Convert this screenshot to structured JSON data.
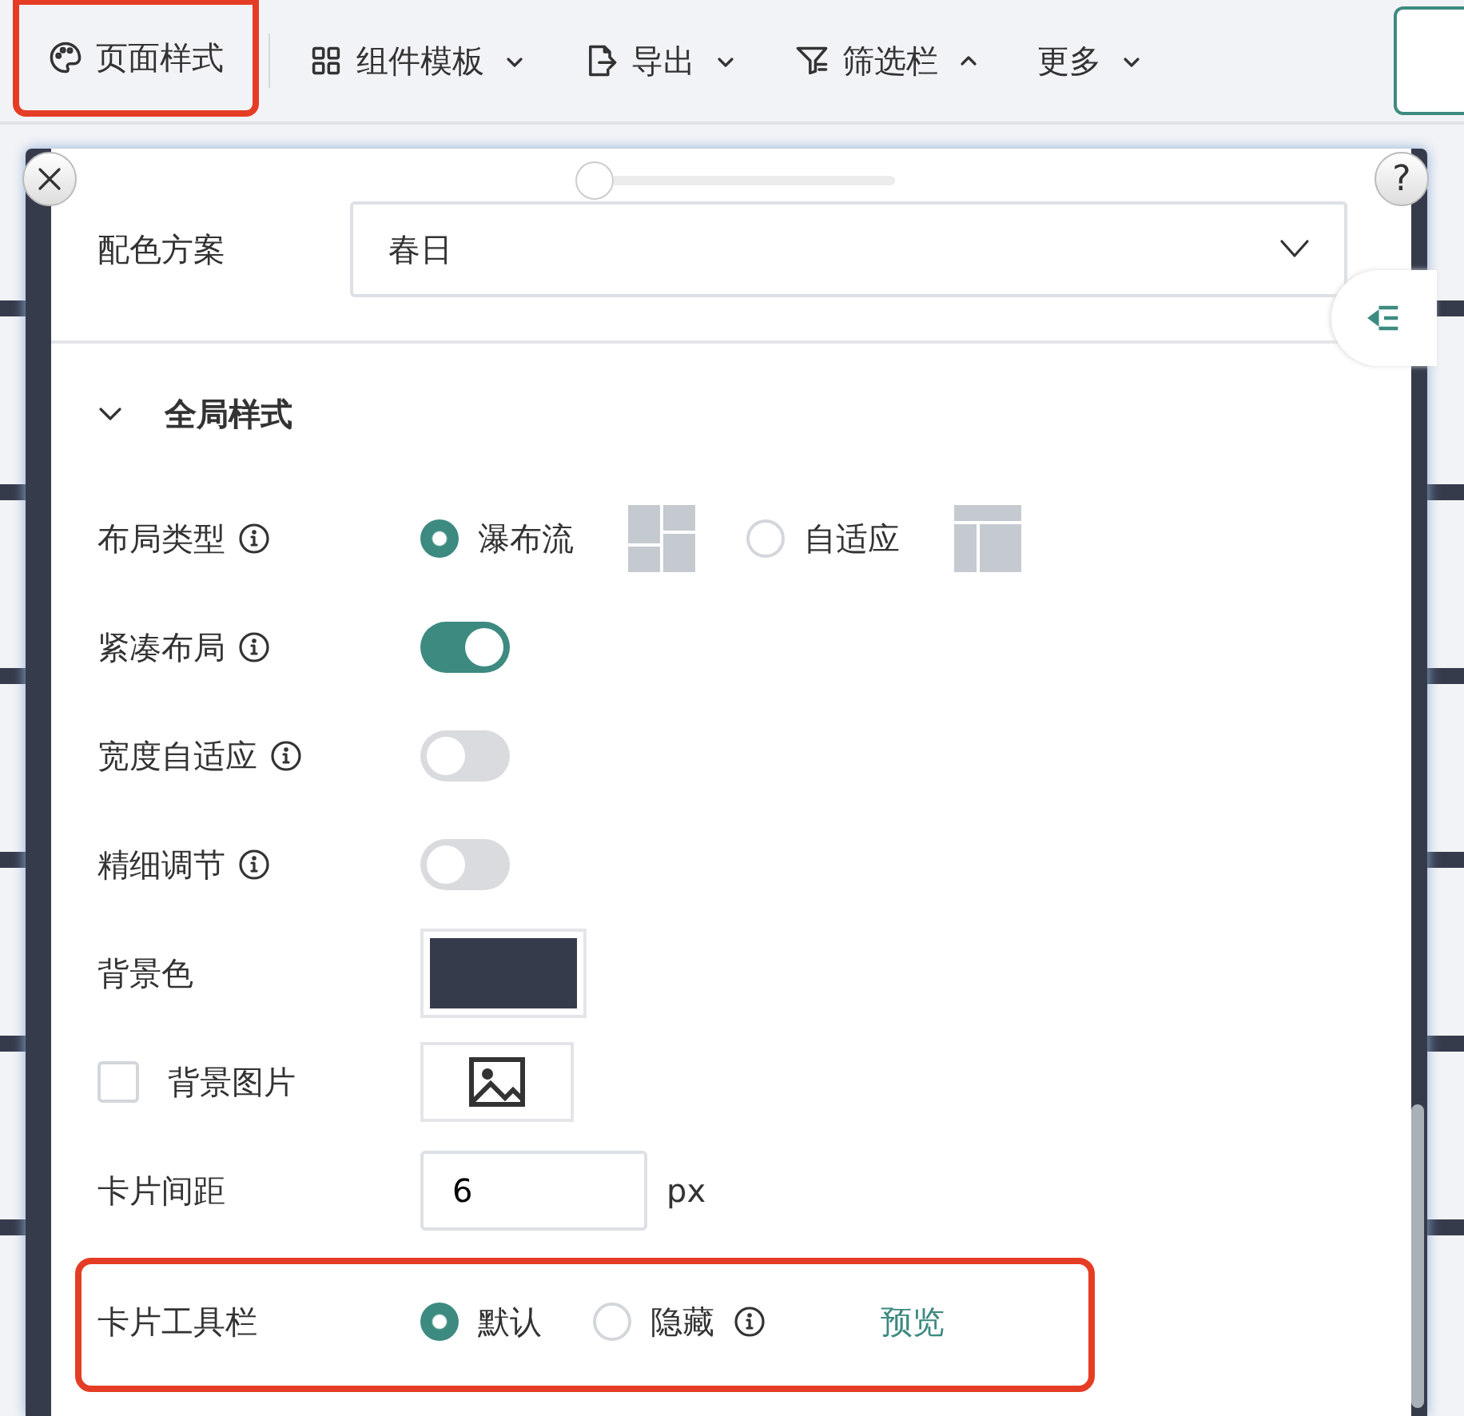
{
  "toolbar": {
    "items": [
      {
        "label": "页面样式",
        "dropdown": false,
        "highlighted": true
      },
      {
        "label": "组件模板",
        "dropdown": true,
        "expanded": false,
        "highlighted": false
      },
      {
        "label": "导出",
        "dropdown": true,
        "expanded": false,
        "highlighted": false
      },
      {
        "label": "筛选栏",
        "dropdown": true,
        "expanded": true,
        "highlighted": false
      },
      {
        "label": "更多",
        "dropdown": true,
        "expanded": false,
        "highlighted": false
      }
    ]
  },
  "panel": {
    "help": "?",
    "color_scheme": {
      "label": "配色方案",
      "value": "春日"
    },
    "section": {
      "title": "全局样式",
      "expanded": true
    },
    "settings": [
      {
        "kind": "radio",
        "label": "布局类型",
        "info": true,
        "options": [
          {
            "label": "瀑布流",
            "selected": true
          },
          {
            "label": "自适应",
            "selected": false
          }
        ]
      },
      {
        "kind": "toggle",
        "label": "紧凑布局",
        "info": true,
        "on": true
      },
      {
        "kind": "toggle",
        "label": "宽度自适应",
        "info": true,
        "on": false
      },
      {
        "kind": "toggle",
        "label": "精细调节",
        "info": true,
        "on": false
      },
      {
        "kind": "color",
        "label": "背景色",
        "color": "#363b4c"
      },
      {
        "kind": "image",
        "label": "背景图片",
        "checked": false
      },
      {
        "kind": "number",
        "label": "卡片间距",
        "value": "6",
        "unit": "px"
      },
      {
        "kind": "radio",
        "label": "卡片工具栏",
        "info": false,
        "highlighted": true,
        "options": [
          {
            "label": "默认",
            "selected": true,
            "info": false
          },
          {
            "label": "隐藏",
            "selected": false,
            "info": true
          }
        ],
        "link": "预览"
      }
    ]
  }
}
